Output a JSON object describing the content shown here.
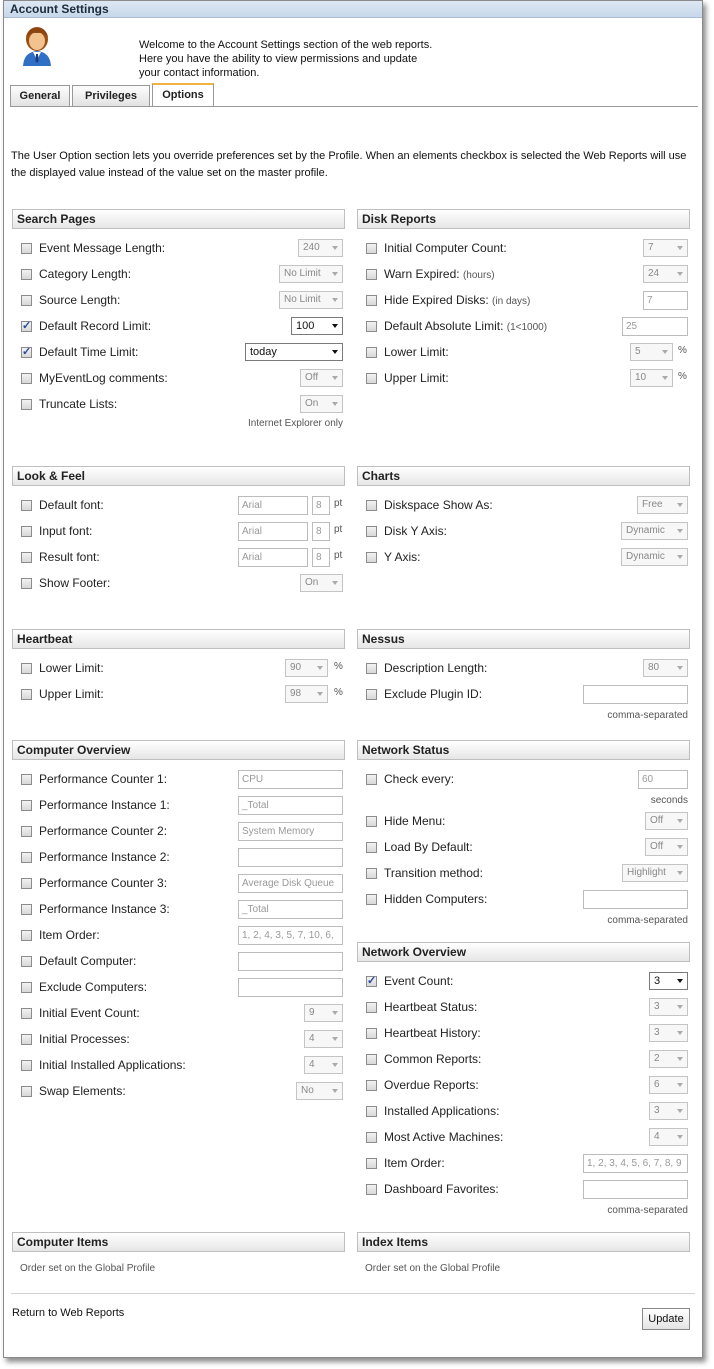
{
  "window": {
    "title": "Account Settings"
  },
  "welcome": {
    "lines": [
      "Welcome to the Account Settings section of the web reports.",
      "Here you have the ability to view permissions and update",
      "your contact information."
    ]
  },
  "tabs": [
    {
      "label": "General"
    },
    {
      "label": "Privileges"
    },
    {
      "label": "Options",
      "active": true
    }
  ],
  "intro": "The User Option section lets you override preferences set by the Profile. When an elements checkbox is selected the Web Reports will use the displayed value instead of the value set on the master profile.",
  "search_pages": {
    "title": "Search Pages",
    "event_message_length": {
      "label": "Event Message Length:",
      "value": "240"
    },
    "category_length": {
      "label": "Category Length:",
      "value": "No Limit"
    },
    "source_length": {
      "label": "Source Length:",
      "value": "No Limit"
    },
    "default_record_limit": {
      "label": "Default Record Limit:",
      "value": "100",
      "checked": true
    },
    "default_time_limit": {
      "label": "Default Time Limit:",
      "value": "today",
      "checked": true
    },
    "myeventlog_comments": {
      "label": "MyEventLog comments:",
      "value": "Off"
    },
    "truncate_lists": {
      "label": "Truncate Lists:",
      "value": "On"
    },
    "note": "Internet Explorer only"
  },
  "disk_reports": {
    "title": "Disk Reports",
    "initial_computer_count": {
      "label": "Initial Computer Count:",
      "value": "7"
    },
    "warn_expired": {
      "label": "Warn Expired:",
      "hint": "(hours)",
      "value": "24"
    },
    "hide_expired_disks": {
      "label": "Hide Expired Disks:",
      "hint": "(in days)",
      "value": "7"
    },
    "default_absolute_limit": {
      "label": "Default Absolute Limit:",
      "hint": "(1<1000)",
      "value": "25"
    },
    "lower_limit": {
      "label": "Lower Limit:",
      "value": "5",
      "unit": "%"
    },
    "upper_limit": {
      "label": "Upper Limit:",
      "value": "10",
      "unit": "%"
    }
  },
  "look_feel": {
    "title": "Look & Feel",
    "default_font": {
      "label": "Default font:",
      "font": "Arial",
      "size": "8",
      "unit": "pt"
    },
    "input_font": {
      "label": "Input font:",
      "font": "Arial",
      "size": "8",
      "unit": "pt"
    },
    "result_font": {
      "label": "Result font:",
      "font": "Arial",
      "size": "8",
      "unit": "pt"
    },
    "show_footer": {
      "label": "Show Footer:",
      "value": "On"
    }
  },
  "charts": {
    "title": "Charts",
    "diskspace_show_as": {
      "label": "Diskspace Show As:",
      "value": "Free"
    },
    "disk_y_axis": {
      "label": "Disk Y Axis:",
      "value": "Dynamic"
    },
    "y_axis": {
      "label": "Y Axis:",
      "value": "Dynamic"
    }
  },
  "heartbeat": {
    "title": "Heartbeat",
    "lower_limit": {
      "label": "Lower Limit:",
      "value": "90",
      "unit": "%"
    },
    "upper_limit": {
      "label": "Upper Limit:",
      "value": "98",
      "unit": "%"
    }
  },
  "nessus": {
    "title": "Nessus",
    "description_length": {
      "label": "Description Length:",
      "value": "80"
    },
    "exclude_plugin_id": {
      "label": "Exclude Plugin ID:",
      "value": ""
    },
    "note": "comma-separated"
  },
  "computer_overview": {
    "title": "Computer Overview",
    "perf_counter_1": {
      "label": "Performance Counter 1:",
      "value": "CPU"
    },
    "perf_instance_1": {
      "label": "Performance Instance 1:",
      "value": "_Total"
    },
    "perf_counter_2": {
      "label": "Performance Counter 2:",
      "value": "System Memory"
    },
    "perf_instance_2": {
      "label": "Performance Instance 2:",
      "value": ""
    },
    "perf_counter_3": {
      "label": "Performance Counter 3:",
      "value": "Average Disk Queue"
    },
    "perf_instance_3": {
      "label": "Performance Instance 3:",
      "value": "_Total"
    },
    "item_order": {
      "label": "Item Order:",
      "value": "1, 2, 4, 3, 5, 7, 10, 6,"
    },
    "default_computer": {
      "label": "Default Computer:",
      "value": ""
    },
    "exclude_computers": {
      "label": "Exclude Computers:",
      "value": ""
    },
    "initial_event_count": {
      "label": "Initial Event Count:",
      "value": "9"
    },
    "initial_processes": {
      "label": "Initial Processes:",
      "value": "4"
    },
    "initial_installed_apps": {
      "label": "Initial Installed Applications:",
      "value": "4"
    },
    "swap_elements": {
      "label": "Swap Elements:",
      "value": "No"
    }
  },
  "network_status": {
    "title": "Network Status",
    "check_every": {
      "label": "Check every:",
      "value": "60",
      "note": "seconds"
    },
    "hide_menu": {
      "label": "Hide Menu:",
      "value": "Off"
    },
    "load_by_default": {
      "label": "Load By Default:",
      "value": "Off"
    },
    "transition_method": {
      "label": "Transition method:",
      "value": "Highlight"
    },
    "hidden_computers": {
      "label": "Hidden Computers:",
      "value": ""
    },
    "note": "comma-separated"
  },
  "network_overview": {
    "title": "Network Overview",
    "event_count": {
      "label": "Event Count:",
      "value": "3",
      "checked": true
    },
    "heartbeat_status": {
      "label": "Heartbeat Status:",
      "value": "3"
    },
    "heartbeat_history": {
      "label": "Heartbeat History:",
      "value": "3"
    },
    "common_reports": {
      "label": "Common Reports:",
      "value": "2"
    },
    "overdue_reports": {
      "label": "Overdue Reports:",
      "value": "6"
    },
    "installed_applications": {
      "label": "Installed Applications:",
      "value": "3"
    },
    "most_active_machines": {
      "label": "Most Active Machines:",
      "value": "4"
    },
    "item_order": {
      "label": "Item Order:",
      "value": "1, 2, 3, 4, 5, 6, 7, 8, 9"
    },
    "dashboard_favorites": {
      "label": "Dashboard Favorites:",
      "value": ""
    },
    "note": "comma-separated"
  },
  "computer_items": {
    "title": "Computer Items",
    "note": "Order set on the Global Profile"
  },
  "index_items": {
    "title": "Index Items",
    "note": "Order set on the Global Profile"
  },
  "footer": {
    "return_link": "Return to Web Reports",
    "update_button": "Update"
  }
}
